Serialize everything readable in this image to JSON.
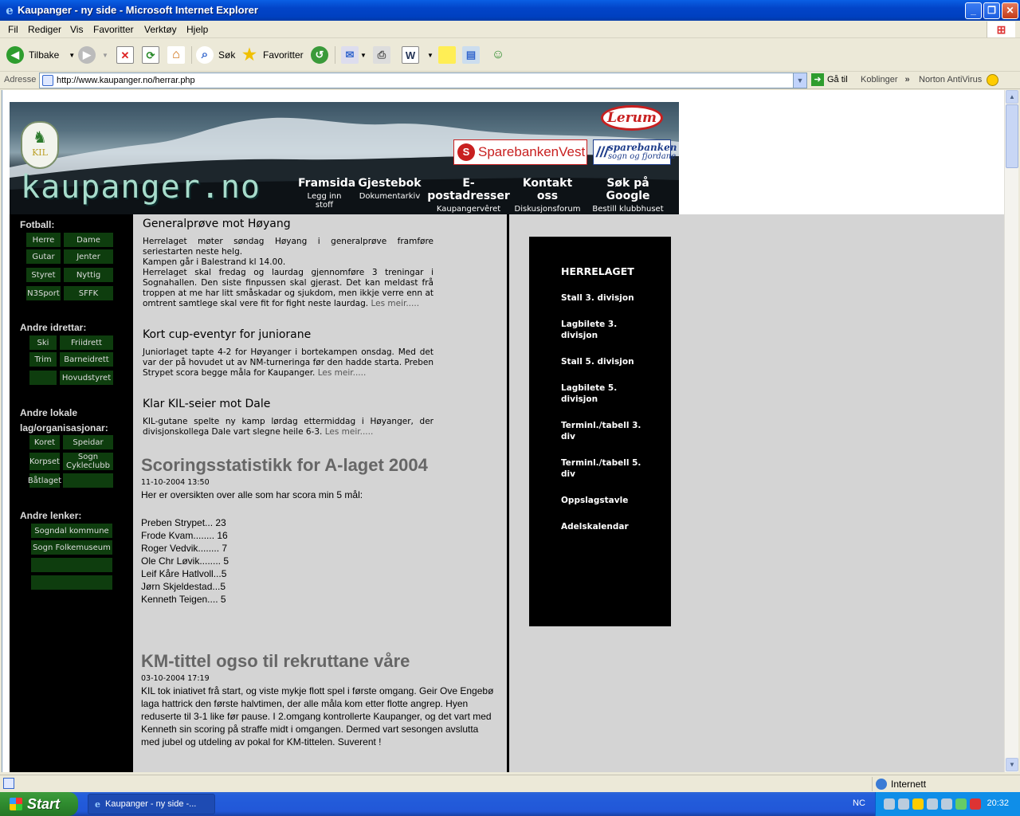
{
  "window": {
    "title": "Kaupanger - ny side - Microsoft Internet Explorer"
  },
  "menu": [
    "Fil",
    "Rediger",
    "Vis",
    "Favoritter",
    "Verktøy",
    "Hjelp"
  ],
  "toolbar": {
    "back": "Tilbake",
    "search": "Søk",
    "favorites": "Favoritter"
  },
  "address": {
    "label": "Adresse",
    "url": "http://www.kaupanger.no/herrar.php",
    "go": "Gå til",
    "links": "Koblinger",
    "norton": "Norton AntiVirus"
  },
  "status": {
    "zone": "Internett"
  },
  "taskbar": {
    "start": "Start",
    "task": "Kaupanger - ny side -...",
    "lang": "NC",
    "clock": "20:32"
  },
  "banner": {
    "brand": "kaupanger.no",
    "sponsor1": "Lerum",
    "sponsor2": "SparebankenVest",
    "sponsor3_line1": "sparebanken",
    "sponsor3_line2": "sogn og fjordane",
    "nav": [
      {
        "main": "Framsida",
        "sub": "Legg inn stoff"
      },
      {
        "main": "Gjestebok",
        "sub": "Dokumentarkiv"
      },
      {
        "main": "E-postadresser",
        "sub": "Kaupangervêret"
      },
      {
        "main": "Kontakt oss",
        "sub": "Diskusjonsforum"
      },
      {
        "main": "Søk på Google",
        "sub": "Bestill klubbhuset"
      }
    ]
  },
  "left": {
    "fotball_head": "Fotball:",
    "fotball": [
      "Herre",
      "Dame",
      "Gutar",
      "Jenter",
      "Styret",
      "Nyttig",
      "N3Sport",
      "SFFK"
    ],
    "idrett_head": "Andre idrettar:",
    "idrett": [
      "Ski",
      "Friidrett",
      "Trim",
      "Barneidrett",
      "",
      "Hovudstyret"
    ],
    "lokale_head1": "Andre lokale",
    "lokale_head2": "lag/organisasjonar:",
    "lokale": [
      "Koret",
      "Speidar",
      "Korpset",
      "Sogn Cykleclubb",
      "Båtlaget",
      ""
    ],
    "lenker_head": "Andre lenker:",
    "lenker": [
      "Sogndal kommune",
      "Sogn Folkemuseum",
      "",
      ""
    ]
  },
  "news": [
    {
      "title": "Generalprøve mot Høyang",
      "body": "Herrelaget møter søndag Høyang i generalprøve framføre seriestarten neste helg.",
      "body2": "Kampen går i Balestrand kl 14.00.",
      "body3": "Herrelaget skal fredag og laurdag gjennomføre 3 treningar i Sognahallen. Den siste finpussen skal gjerast. Det kan meldast frå troppen at me har litt småskadar og sjukdom, men ikkje verre enn at omtrent samtlege skal vere fit for fight neste laurdag.",
      "more": "Les meir....."
    },
    {
      "title": "Kort cup-eventyr for juniorane",
      "body": "Juniorlaget tapte 4-2 for Høyanger i bortekampen onsdag. Med det var der på hovudet ut av NM-turneringa før den hadde starta. Preben Strypet scora begge måla for Kaupanger.",
      "more": "Les meir....."
    },
    {
      "title": "Klar KIL-seier mot Dale",
      "body": "KIL-gutane spelte ny kamp lørdag ettermiddag i Høyanger, der divisjonskollega Dale vart slegne heile 6-3.",
      "more": "Les meir....."
    }
  ],
  "article1": {
    "title": "Scoringsstatistikk for A-laget 2004",
    "date": "11-10-2004 13:50",
    "intro": "Her er oversikten over alle som har scora min 5 mål:",
    "scorers": [
      "Preben Strypet... 23",
      "Frode Kvam........ 16",
      "Roger Vedvik........ 7",
      "Ole Chr Løvik........ 5",
      "Leif Kåre Hatlvoll...5",
      "Jørn Skjeldestad...5",
      "Kenneth Teigen.... 5"
    ]
  },
  "article2": {
    "title": "KM-tittel ogso til rekruttane våre",
    "date": "03-10-2004 17:19",
    "body": "KIL tok iniativet frå start, og viste mykje flott spel i første omgang. Geir Ove Engebø laga hattrick den første halvtimen, der alle måla kom etter flotte angrep. Hyen reduserte til 3-1 like før pause. I 2.omgang kontrollerte Kaupanger, og det vart med Kenneth sin scoring på straffe midt i omgangen. Dermed vart sesongen avslutta med jubel og utdeling av pokal for KM-tittelen. Suverent !"
  },
  "herrelaget": {
    "head": "HERRELAGET",
    "links": [
      "Stall 3. divisjon",
      "Lagbilete 3. divisjon",
      "Stall 5. divisjon",
      "Lagbilete 5. divisjon",
      "Terminl./tabell 3. div",
      "Terminl./tabell 5. div",
      "Oppslagstavle",
      "Adelskalendar"
    ]
  }
}
